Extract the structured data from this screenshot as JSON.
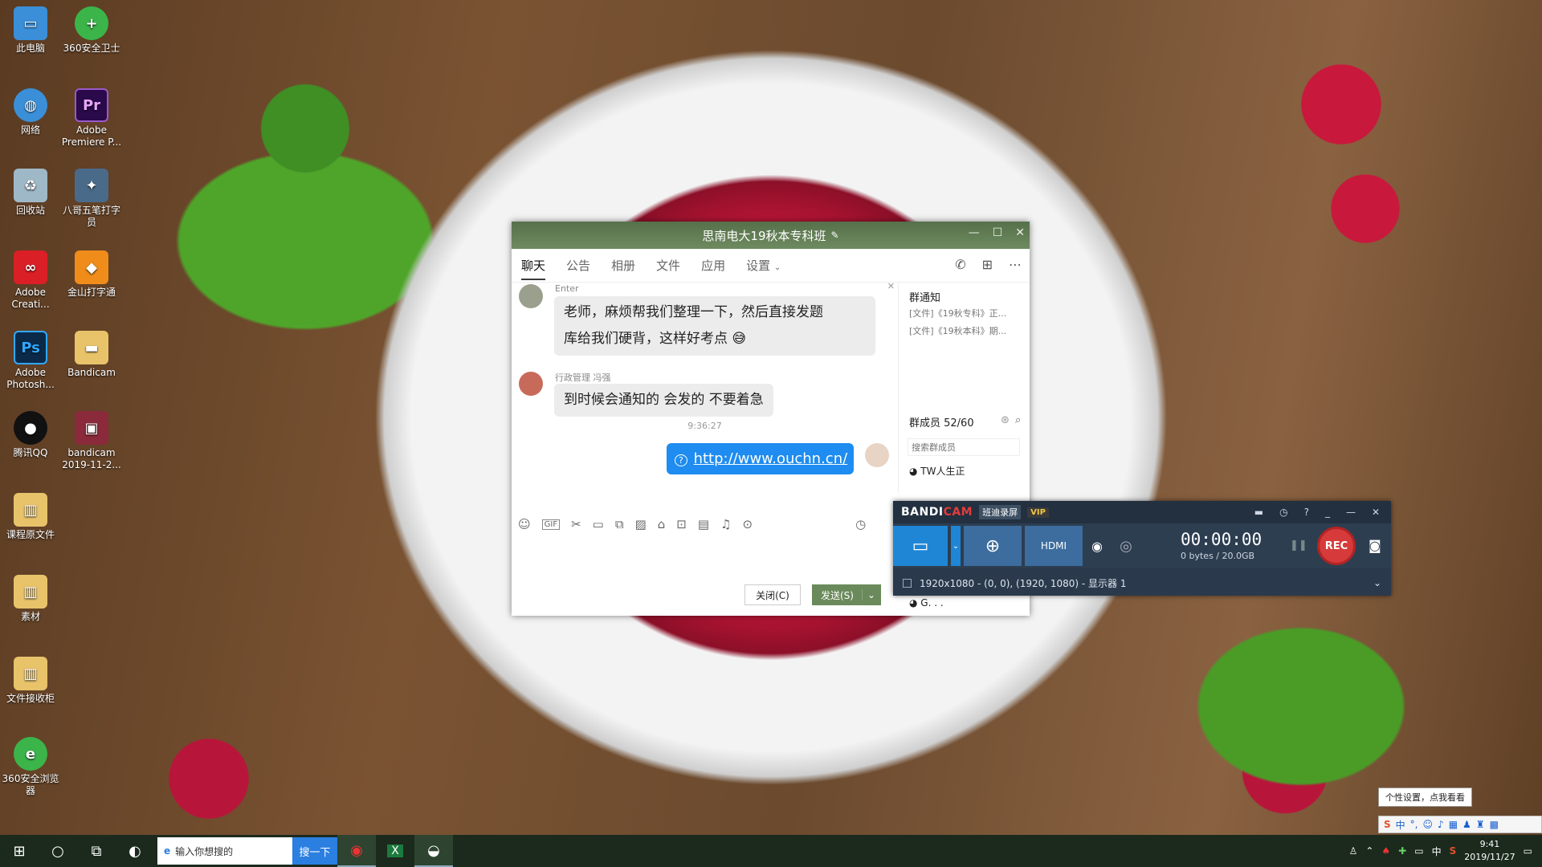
{
  "desktop": {
    "icons": [
      {
        "label": "此电脑",
        "icon": "computer-icon",
        "color": "#3a8fd8"
      },
      {
        "label": "360安全卫士",
        "icon": "360-security-icon",
        "color": "#3bb54a"
      },
      {
        "label": "网络",
        "icon": "network-icon",
        "color": "#3a8fd8"
      },
      {
        "label": "Adobe Premiere P...",
        "icon": "premiere-icon",
        "color": "#2a0a4a"
      },
      {
        "label": "回收站",
        "icon": "recycle-bin-icon",
        "color": "#9fb8c8"
      },
      {
        "label": "八哥五笔打字员",
        "icon": "bird-icon",
        "color": "#4a6a8a"
      },
      {
        "label": "Adobe Creati...",
        "icon": "creative-cloud-icon",
        "color": "#da1f26"
      },
      {
        "label": "金山打字通",
        "icon": "kingsoft-typing-icon",
        "color": "#f08c1a"
      },
      {
        "label": "Adobe Photosh...",
        "icon": "photoshop-icon",
        "color": "#0b2a4a"
      },
      {
        "label": "Bandicam",
        "icon": "folder-icon",
        "color": "#e8c36a"
      },
      {
        "label": "腾讯QQ",
        "icon": "qq-icon",
        "color": "#111111"
      },
      {
        "label": "bandicam 2019-11-2...",
        "icon": "image-file-icon",
        "color": "#8a2a3a"
      },
      {
        "label": "课程原文件",
        "icon": "zip-folder-icon",
        "color": "#e8c36a"
      },
      {
        "label": "素材",
        "icon": "zip-folder-icon",
        "color": "#e8c36a"
      },
      {
        "label": "文件接收柜",
        "icon": "zip-folder-icon",
        "color": "#e8c36a"
      },
      {
        "label": "360安全浏览器",
        "icon": "360-browser-icon",
        "color": "#3bb54a"
      }
    ]
  },
  "chat": {
    "title": "思南电大19秋本专科班",
    "tabs": [
      "聊天",
      "公告",
      "相册",
      "文件",
      "应用",
      "设置"
    ],
    "messages": [
      {
        "sender": "Enter",
        "text_line1": "老师，麻烦帮我们整理一下，然后直接发题",
        "text_line2": "库给我们硬背，这样好考点"
      },
      {
        "sender": "行政管理 冯强",
        "text": "到时候会通知的 会发的 不要着急"
      }
    ],
    "time": "9:36:27",
    "my_message": "http://www.ouchn.cn/",
    "close_btn": "关闭(C)",
    "send_btn": "发送(S)",
    "side": {
      "notice_title": "群通知",
      "notice_1": "[文件]《19秋专科》正...",
      "notice_2": "[文件]《19秋本科》期...",
      "members_title": "群成员 52/60",
      "search_placeholder": "搜索群成员",
      "member_1": "TW人生正",
      "member_2": "G. . ."
    }
  },
  "bandicam": {
    "logo_a": "BANDI",
    "logo_b": "CAM",
    "tag": "班迪录屏",
    "vip": "VIP",
    "timer": "00:00:00",
    "bytes": "0 bytes / 20.0GB",
    "rec": "REC",
    "area": "1920x1080 - (0, 0), (1920, 1080) - 显示器 1"
  },
  "taskbar": {
    "search_placeholder": "输入你想搜的",
    "search_button": "搜一下",
    "time": "9:41",
    "date": "2019/11/27",
    "ime": "中",
    "tooltip": "个性设置，点我看看"
  },
  "colors": {
    "accent": "#1e8cf0",
    "chat_title": "#6e8a5f",
    "bandicam_bg": "#2a3a4c",
    "rec": "#d63a3a"
  }
}
